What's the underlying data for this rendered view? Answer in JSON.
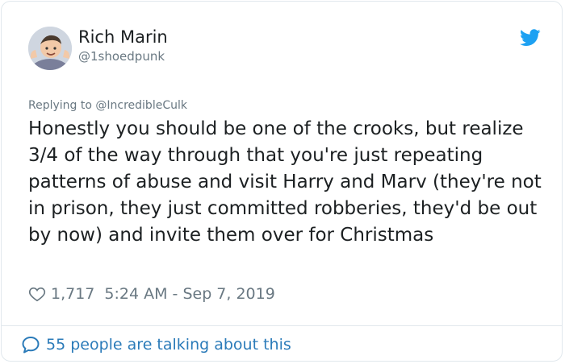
{
  "author": {
    "name": "Rich Marin",
    "handle": "@1shoedpunk"
  },
  "reply": {
    "prefix": "Replying to ",
    "target": "@IncredibleCulk"
  },
  "tweet": {
    "text": "Honestly you should be one of the crooks, but realize 3/4 of the way through that you're just repeating patterns of abuse and visit Harry and Marv (they're not in prison, they just committed robberies, they'd be out by now) and invite them over for Christmas"
  },
  "meta": {
    "likes": "1,717",
    "timestamp": "5:24 AM - Sep 7, 2019"
  },
  "footer": {
    "talking": "55 people are talking about this"
  },
  "colors": {
    "twitter_blue": "#1da1f2",
    "link_blue": "#2b7bb9",
    "muted": "#697882",
    "text": "#1c2022"
  },
  "icons": [
    "avatar",
    "twitter-bird-icon",
    "heart-icon",
    "chat-bubble-icon"
  ]
}
